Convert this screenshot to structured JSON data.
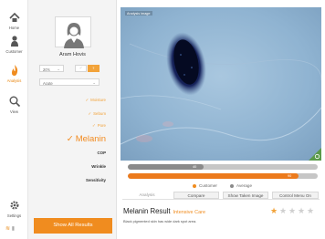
{
  "nav": {
    "items": [
      {
        "label": "Home",
        "icon": "home-icon"
      },
      {
        "label": "Customer",
        "icon": "person-icon"
      },
      {
        "label": "Analysis",
        "icon": "flame-icon",
        "active": true
      },
      {
        "label": "View",
        "icon": "magnifier-icon"
      },
      {
        "label": "Settings",
        "icon": "gear-icon"
      }
    ]
  },
  "customer": {
    "name": "Aram Hovis",
    "age_value": "20's",
    "skin_value": "Acute",
    "gender_male_icon": "♂",
    "gender_female_icon": "♀"
  },
  "metrics": {
    "done": [
      "Moisture",
      "Sebum",
      "Pore"
    ],
    "current": "Melanin",
    "pending": [
      "COP",
      "Wrinkle",
      "Sensitivity"
    ]
  },
  "buttons": {
    "show_all": "Show All Results"
  },
  "image": {
    "label": "Analysis image"
  },
  "bars": {
    "customer": {
      "value": 40,
      "label": "40"
    },
    "average": {
      "value": 90,
      "label": "90"
    }
  },
  "legend": {
    "customer": "Customer",
    "average": "Average"
  },
  "tabs": [
    "Analysis",
    "Compare",
    "Show Taken Image",
    "Control Menu On"
  ],
  "result": {
    "title": "Melanin Result",
    "grade": "Intensive Care",
    "description": "Black pigmented skin has wide dark spot area.",
    "stars": 1,
    "stars_max": 5
  },
  "colors": {
    "accent": "#f08c1f",
    "bar_customer": "#8a8a8a",
    "bar_average": "#ec7a1c",
    "star_on": "#f2a33a",
    "star_off": "#cfcfcf"
  }
}
